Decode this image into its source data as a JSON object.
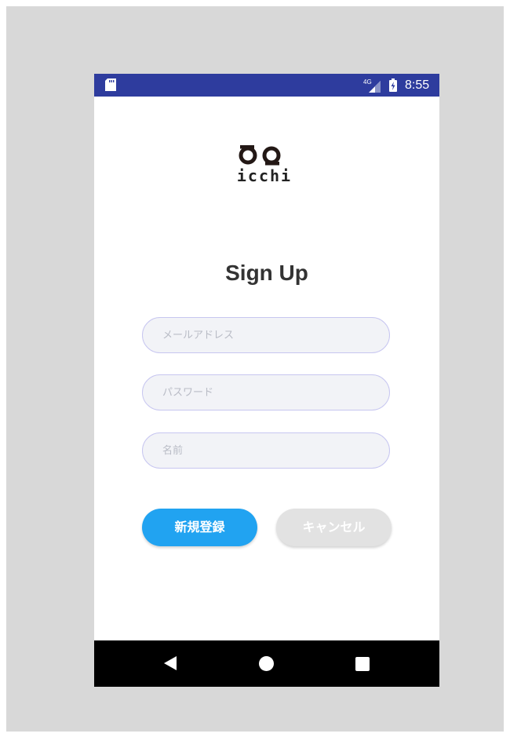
{
  "status_bar": {
    "network": "4G",
    "time": "8:55"
  },
  "logo": {
    "text": "icchi"
  },
  "title": "Sign Up",
  "form": {
    "email": {
      "value": "",
      "placeholder": "メールアドレス"
    },
    "password": {
      "value": "",
      "placeholder": "パスワード"
    },
    "name": {
      "value": "",
      "placeholder": "名前"
    }
  },
  "buttons": {
    "register_label": "新規登録",
    "cancel_label": "キャンセル"
  },
  "colors": {
    "status_bar": "#2e3c9e",
    "primary": "#21a3f1",
    "cancel": "#e2e2e2",
    "field_bg": "#f2f3f7",
    "field_border": "#c7c6f0"
  },
  "icons": {
    "status": [
      "sd-card-icon",
      "network-4g-icon",
      "battery-charging-icon"
    ],
    "nav": [
      "back-icon",
      "home-icon",
      "recents-icon"
    ]
  }
}
